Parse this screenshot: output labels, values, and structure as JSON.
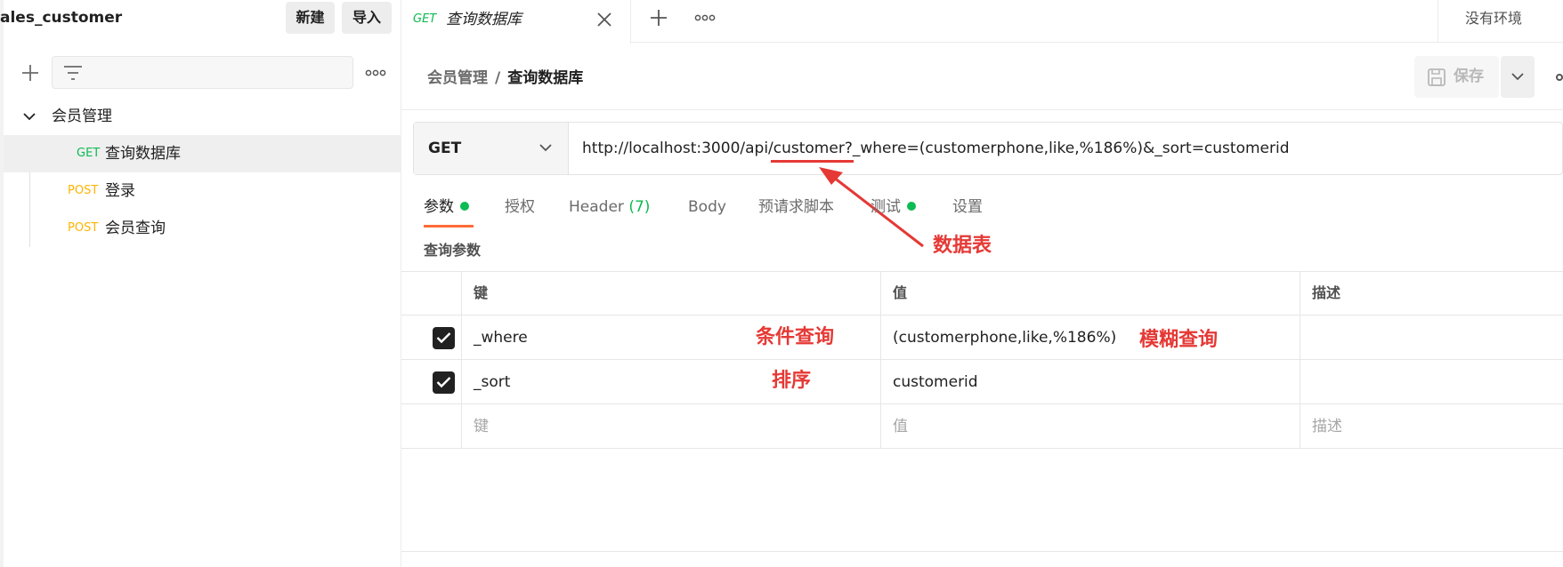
{
  "workspace": {
    "title": "ales_customer",
    "new_label": "新建",
    "import_label": "导入"
  },
  "sidebar": {
    "folder": "会员管理",
    "requests": [
      {
        "method": "GET",
        "name": "查询数据库"
      },
      {
        "method": "POST",
        "name": "登录"
      },
      {
        "method": "POST",
        "name": "会员查询"
      }
    ]
  },
  "tabs": {
    "active": {
      "method": "GET",
      "name": "查询数据库"
    },
    "environment": "没有环境"
  },
  "header": {
    "breadcrumb_parent": "会员管理",
    "breadcrumb_sep": "/",
    "breadcrumb_current": "查询数据库",
    "save_label": "保存"
  },
  "request": {
    "method": "GET",
    "url": "http://localhost:3000/api/customer?_where=(customerphone,like,%186%)&_sort=customerid"
  },
  "request_tabs": [
    {
      "label": "参数",
      "dot": true
    },
    {
      "label": "授权"
    },
    {
      "label": "Header",
      "count": "(7)"
    },
    {
      "label": "Body"
    },
    {
      "label": "预请求脚本"
    },
    {
      "label": "测试",
      "dot": true
    },
    {
      "label": "设置"
    }
  ],
  "params": {
    "section_title": "查询参数",
    "headers": {
      "key": "键",
      "value": "值",
      "description": "描述"
    },
    "rows": [
      {
        "checked": true,
        "key": "_where",
        "value": "(customerphone,like,%186%)",
        "description": ""
      },
      {
        "checked": true,
        "key": "_sort",
        "value": "customerid",
        "description": ""
      }
    ],
    "placeholders": {
      "key": "键",
      "value": "值",
      "description": "描述"
    }
  },
  "annotations": {
    "table": "数据表",
    "condition": "条件查询",
    "fuzzy": "模糊查询",
    "sort": "排序",
    "color": "#e53935"
  },
  "colors": {
    "get": "#0cbb52",
    "post": "#ffb400",
    "accent": "#ff6c37"
  }
}
